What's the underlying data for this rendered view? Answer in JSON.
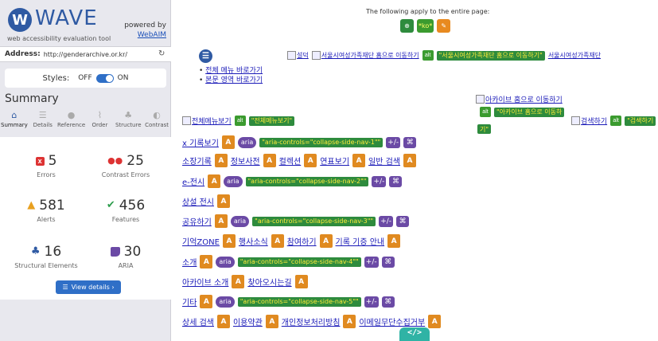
{
  "sidebar": {
    "logo_text": "WAVE",
    "logo_mark": "W",
    "logo_sub": "web accessibility evaluation tool",
    "powered_by": "powered by",
    "powered_link": "WebAIM",
    "address_label": "Address:",
    "address_value": "http://genderarchive.or.kr/",
    "styles_label": "Styles:",
    "styles_off": "OFF",
    "styles_on": "ON",
    "styles_state": "on",
    "summary_title": "Summary",
    "tabs": [
      {
        "label": "Summary",
        "icon": "home-icon",
        "glyph": "⌂"
      },
      {
        "label": "Details",
        "icon": "list-icon",
        "glyph": "☰"
      },
      {
        "label": "Reference",
        "icon": "info-icon",
        "glyph": "●"
      },
      {
        "label": "Order",
        "icon": "order-icon",
        "glyph": "⌇"
      },
      {
        "label": "Structure",
        "icon": "structure-icon",
        "glyph": "♣"
      },
      {
        "label": "Contrast",
        "icon": "contrast-icon",
        "glyph": "◐"
      }
    ],
    "stats": {
      "errors": {
        "value": "5",
        "label": "Errors",
        "icon_glyph": "x"
      },
      "contrast_errors": {
        "value": "25",
        "label": "Contrast Errors",
        "icon_glyph": "●●"
      },
      "alerts": {
        "value": "581",
        "label": "Alerts",
        "icon_glyph": "▲"
      },
      "features": {
        "value": "456",
        "label": "Features",
        "icon_glyph": "✔"
      },
      "structural": {
        "value": "16",
        "label": "Structural Elements",
        "icon_glyph": "♣"
      },
      "aria": {
        "value": "30",
        "label": "ARIA"
      }
    },
    "view_details": "View details ›",
    "view_details_glyph": "☰"
  },
  "main": {
    "top_message": "The following apply to the entire page:",
    "page_icon_lang": "*ko*",
    "page_icon_globe_glyph": "⊕",
    "page_icon_flag_glyph": "✎",
    "circle_glyph": "☰",
    "skip_links": [
      "전체 메뉴 바로가기",
      "본문 영역 바로가기"
    ],
    "header_links": {
      "broken1": "설덕",
      "link1": "서울시여성가족재단 홈으로 이동하기",
      "alt1": "\"서울시여성가족재단 홈으로 이동하기\"",
      "tail1": "서울시여성가족재단"
    },
    "archive_home": "아카이브 홈으로 이동하기",
    "archive_alt": "\"아카이브 홈으로 이동하",
    "archive_alt2": "기\"",
    "all_menu": "전체메뉴보기",
    "all_menu_alt": "\"전체메뉴보기\"",
    "search_link": "검색하기",
    "search_alt": "\"검색하기",
    "nav": [
      {
        "items": [
          "x 기록보기"
        ],
        "aria": "aria",
        "controls": "\"aria-controls=\"collapse-side-nav-1\"\"",
        "pm": "+/-",
        "kb": "⌘"
      },
      {
        "items": [
          "소장기록",
          "정보사전",
          "컬렉션",
          "연표보기",
          "일반 검색"
        ]
      },
      {
        "items": [
          "e-전시"
        ],
        "aria": "aria",
        "controls": "\"aria-controls=\"collapse-side-nav-2\"\"",
        "pm": "+/-",
        "kb": "⌘"
      },
      {
        "items": [
          "상설 전시"
        ]
      },
      {
        "items": [
          "공유하기"
        ],
        "aria": "aria",
        "controls": "\"aria-controls=\"collapse-side-nav-3\"\"",
        "pm": "+/-",
        "kb": "⌘"
      },
      {
        "items": [
          "기억ZONE",
          "행사소식",
          "참여하기",
          "기록 기증 안내"
        ]
      },
      {
        "items": [
          "소개"
        ],
        "aria": "aria",
        "controls": "\"aria-controls=\"collapse-side-nav-4\"\"",
        "pm": "+/-",
        "kb": "⌘"
      },
      {
        "items": [
          "아카이브 소개",
          "찾아오시는길"
        ]
      },
      {
        "items": [
          "기타"
        ],
        "aria": "aria",
        "controls": "\"aria-controls=\"collapse-side-nav-5\"\"",
        "pm": "+/-",
        "kb": "⌘"
      },
      {
        "items": [
          "상세 검색",
          "이용약관",
          "개인정보처리방침",
          "이메일무단수집거부"
        ]
      }
    ],
    "orange_glyph": "A",
    "alt_glyph": "alt",
    "code_button": "</>"
  }
}
